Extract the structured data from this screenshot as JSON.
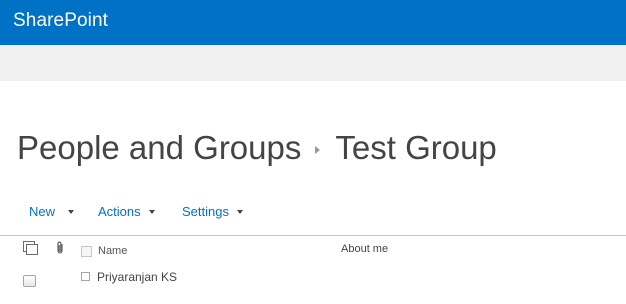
{
  "suite_bar": {
    "brand": "SharePoint",
    "color": "#0072c6"
  },
  "page_title": {
    "parent": "People and Groups",
    "separator_icon": "breadcrumb-arrow-icon",
    "current": "Test Group"
  },
  "toolbar": {
    "new_label": "New",
    "actions_label": "Actions",
    "settings_label": "Settings",
    "link_color": "#0072c6"
  },
  "list": {
    "header": {
      "multi_select_icon": "select-items-icon",
      "attachment_icon": "paperclip-icon",
      "name_label": "Name",
      "about_label": "About me"
    },
    "rows": [
      {
        "name": "Priyaranjan KS",
        "about": ""
      }
    ]
  }
}
